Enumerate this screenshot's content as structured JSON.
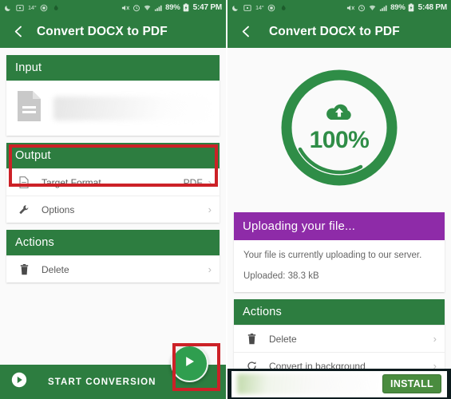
{
  "left": {
    "statusbar": {
      "icons_left": [
        "moon-icon",
        "screenshot-icon",
        "temperature-icon",
        "circle-e-icon",
        "flame-icon"
      ],
      "temperature": "14°",
      "icons_right": [
        "mute-icon",
        "alarm-icon",
        "wifi-icon",
        "signal-icon"
      ],
      "battery_percent": "89%",
      "battery_icon": "battery-icon",
      "time": "5:47 PM"
    },
    "appbar": {
      "back_icon": "back-arrow-icon",
      "title": "Convert DOCX to PDF"
    },
    "input": {
      "header": "Input",
      "file_icon": "document-icon",
      "filename": ""
    },
    "output": {
      "header": "Output",
      "target_format": {
        "icon": "format-icon",
        "label": "Target Format",
        "value": "PDF",
        "chevron": "›"
      },
      "options": {
        "icon": "wrench-icon",
        "label": "Options",
        "chevron": "›"
      }
    },
    "actions": {
      "header": "Actions",
      "items": [
        {
          "icon": "trash-icon",
          "label": "Delete",
          "chevron": "›"
        }
      ]
    },
    "bottom": {
      "play_icon": "play-circle-icon",
      "label": "START CONVERSION"
    },
    "fab": {
      "icon": "play-icon"
    },
    "highlights": [
      "target-format-highlight",
      "fab-highlight"
    ],
    "highlight_color": "#cc2127"
  },
  "right": {
    "statusbar": {
      "temperature": "14°",
      "battery_percent": "89%",
      "time": "5:48 PM"
    },
    "appbar": {
      "back_icon": "back-arrow-icon",
      "title": "Convert DOCX to PDF"
    },
    "progress": {
      "icon": "cloud-upload-icon",
      "percent_label": "100%",
      "percent_value": 100,
      "ring_color": "#2f8d47"
    },
    "upload": {
      "header": "Uploading your file...",
      "header_color": "#8e2ba8",
      "line1": "Your file is currently uploading to our server.",
      "line2": "Uploaded: 38.3 kB"
    },
    "actions": {
      "header": "Actions",
      "items": [
        {
          "icon": "trash-icon",
          "label": "Delete",
          "chevron": "›"
        },
        {
          "icon": "refresh-icon",
          "label": "Convert in background",
          "chevron": "›"
        }
      ]
    },
    "ad": {
      "install_label": "INSTALL"
    }
  },
  "theme": {
    "green": "#2d7d40",
    "purple": "#8e2ba8",
    "red": "#cc2127"
  }
}
